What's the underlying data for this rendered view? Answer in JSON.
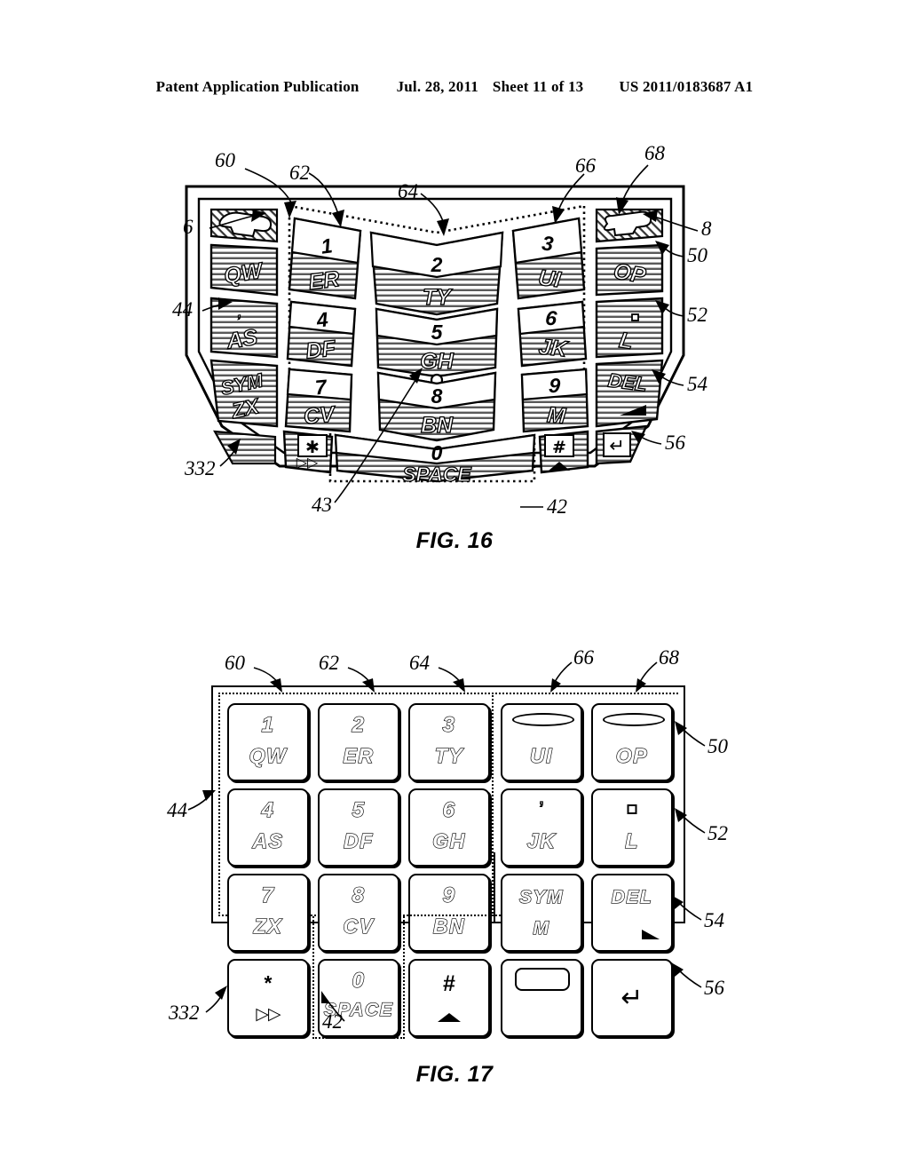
{
  "header": {
    "publication": "Patent Application Publication",
    "date": "Jul. 28, 2011",
    "sheet": "Sheet 11 of 13",
    "docnum": "US 2011/0183687 A1"
  },
  "figures": [
    {
      "id": "fig16",
      "caption": "FIG. 16",
      "description": "Curved contoured keypad assembly, shaded keys",
      "reference_numerals": [
        "60",
        "62",
        "64",
        "66",
        "68",
        "6",
        "8",
        "50",
        "52",
        "54",
        "56",
        "44",
        "332",
        "43",
        "42"
      ]
    },
    {
      "id": "fig17",
      "caption": "FIG. 17",
      "description": "Flat planar keypad layout",
      "reference_numerals": [
        "60",
        "62",
        "64",
        "66",
        "68",
        "50",
        "52",
        "54",
        "56",
        "44",
        "332",
        "42"
      ]
    }
  ],
  "keypad": {
    "rows": [
      [
        {
          "num": "1",
          "letters": "QW",
          "kind": "num-letters"
        },
        {
          "num": "2",
          "letters": "ER",
          "kind": "num-letters"
        },
        {
          "num": "3",
          "letters": "TY",
          "kind": "num-letters"
        },
        {
          "num": "",
          "letters": "UI",
          "kind": "slot-letters"
        },
        {
          "num": "",
          "letters": "OP",
          "kind": "slot-letters"
        }
      ],
      [
        {
          "num": "4",
          "letters": "AS",
          "kind": "num-letters"
        },
        {
          "num": "5",
          "letters": "DF",
          "kind": "num-letters"
        },
        {
          "num": "6",
          "letters": "GH",
          "kind": "num-letters"
        },
        {
          "num": "’",
          "letters": "JK",
          "kind": "apos-letters"
        },
        {
          "num": "▪",
          "letters": "L",
          "kind": "square-letter"
        }
      ],
      [
        {
          "num": "7",
          "letters": "ZX",
          "kind": "num-letters"
        },
        {
          "num": "8",
          "letters": "CV",
          "kind": "num-letters"
        },
        {
          "num": "9",
          "letters": "BN",
          "kind": "num-letters"
        },
        {
          "num": "SYM",
          "letters": "M",
          "kind": "word-letter"
        },
        {
          "num": "DEL",
          "letters": "",
          "kind": "word-triangle"
        }
      ],
      [
        {
          "num": "*",
          "letters": "▷▷",
          "kind": "star-ff"
        },
        {
          "num": "0",
          "letters": "SPACE",
          "kind": "num-word"
        },
        {
          "num": "#",
          "letters": "△",
          "kind": "hash-up"
        },
        {
          "num": "",
          "letters": "",
          "kind": "blank-rect"
        },
        {
          "num": "",
          "letters": "↵",
          "kind": "return"
        }
      ]
    ]
  },
  "labels": {
    "n60": "60",
    "n62": "62",
    "n64": "64",
    "n66": "66",
    "n68": "68",
    "n6": "6",
    "n8": "8",
    "n50": "50",
    "n52": "52",
    "n54": "54",
    "n56": "56",
    "n44": "44",
    "n332": "332",
    "n43": "43",
    "n42": "42"
  },
  "fig16_keys": {
    "col1": [
      "QW",
      "AS",
      "SYM / ZX"
    ],
    "col2": [
      "1 ER",
      "4 DF",
      "7 CV"
    ],
    "col3": [
      "2 TY",
      "5 GH",
      "8 BN"
    ],
    "col4": [
      "3 UI",
      "6 JK",
      "9 M"
    ],
    "col5": [
      "OP",
      "L",
      "DEL"
    ],
    "bottom": [
      "* ▷▷",
      "0 SPACE",
      "# △",
      "↵"
    ]
  },
  "colors": {
    "ink": "#000000",
    "paper": "#ffffff",
    "hatch": "#6f6f6f"
  }
}
